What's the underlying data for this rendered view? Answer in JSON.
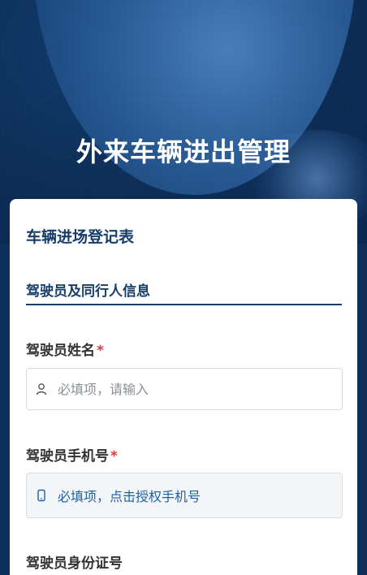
{
  "app_title": "外来车辆进出管理",
  "form_title": "车辆进场登记表",
  "section": {
    "heading": "驾驶员及同行人信息"
  },
  "fields": {
    "driver_name": {
      "label": "驾驶员姓名",
      "required_mark": "*",
      "placeholder": "必填项，请输入",
      "icon": "user-icon"
    },
    "driver_phone": {
      "label": "驾驶员手机号",
      "required_mark": "*",
      "action_text": "必填项，点击授权手机号",
      "icon": "phone-icon"
    },
    "driver_id": {
      "label": "驾驶员身份证号"
    }
  },
  "colors": {
    "brand_dark": "#173e6b",
    "required": "#e03a3a",
    "link": "#1f5f9e",
    "hero_bg": "#0c2d56"
  }
}
